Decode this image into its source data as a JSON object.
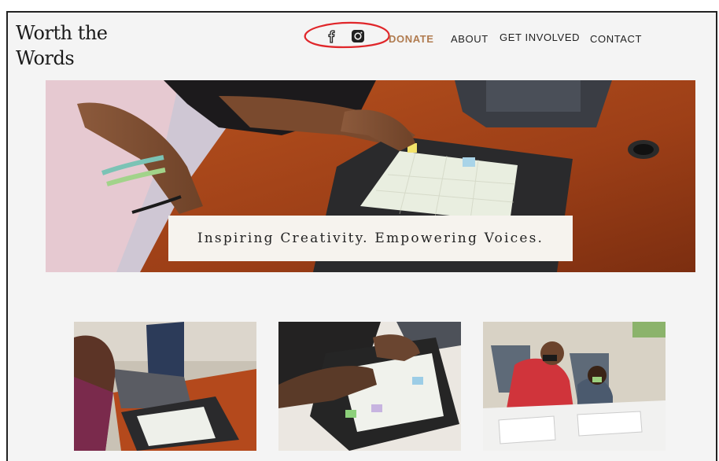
{
  "site": {
    "logo_line1": "Worth the",
    "logo_line2": "Words"
  },
  "nav": {
    "donate": "DONATE",
    "about": "ABOUT",
    "get_involved": "GET INVOLVED",
    "contact": "CONTACT"
  },
  "social": {
    "facebook_icon": "facebook-icon",
    "instagram_icon": "instagram-icon"
  },
  "hero": {
    "tagline": "Inspiring Creativity. Empowering Voices."
  },
  "colors": {
    "accent_donate": "#b07b4f",
    "annotation_red": "#e0262a",
    "background": "#f4f4f4"
  }
}
